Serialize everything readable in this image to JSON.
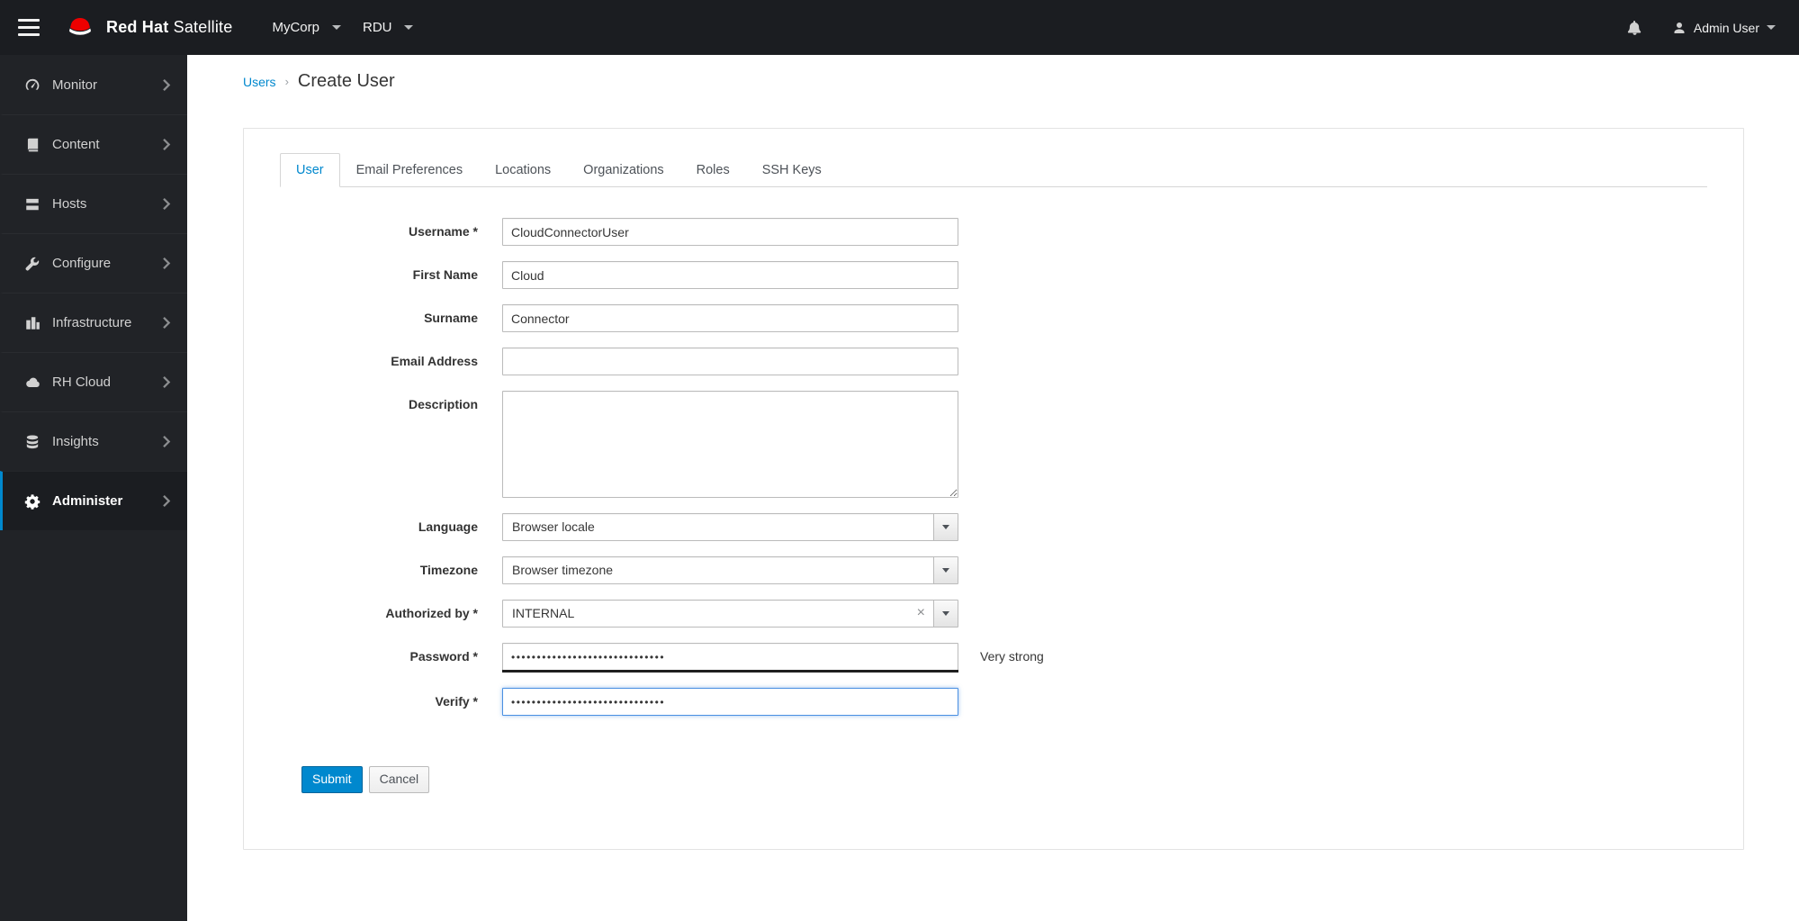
{
  "colors": {
    "accent_blue": "#0088ce",
    "brand_red": "#ee0000",
    "navbar_bg": "#1b1d21",
    "sidebar_bg": "#212327"
  },
  "navbar": {
    "brand_bold": "Red Hat",
    "brand_regular": "Satellite",
    "org_selector": "MyCorp",
    "location_selector": "RDU",
    "user_menu": "Admin User"
  },
  "sidebar": {
    "items": [
      {
        "label": "Monitor",
        "icon": "tachometer-icon"
      },
      {
        "label": "Content",
        "icon": "book-icon"
      },
      {
        "label": "Hosts",
        "icon": "server-icon"
      },
      {
        "label": "Configure",
        "icon": "wrench-icon"
      },
      {
        "label": "Infrastructure",
        "icon": "buildings-icon"
      },
      {
        "label": "RH Cloud",
        "icon": "cloud-icon"
      },
      {
        "label": "Insights",
        "icon": "database-icon"
      },
      {
        "label": "Administer",
        "icon": "gear-icon"
      }
    ]
  },
  "breadcrumb": {
    "parent": "Users",
    "separator": "›",
    "current": "Create User"
  },
  "tabs": [
    {
      "label": "User"
    },
    {
      "label": "Email Preferences"
    },
    {
      "label": "Locations"
    },
    {
      "label": "Organizations"
    },
    {
      "label": "Roles"
    },
    {
      "label": "SSH Keys"
    }
  ],
  "form": {
    "username": {
      "label": "Username *",
      "value": "CloudConnectorUser"
    },
    "first_name": {
      "label": "First Name",
      "value": "Cloud"
    },
    "surname": {
      "label": "Surname",
      "value": "Connector"
    },
    "email": {
      "label": "Email Address",
      "value": ""
    },
    "description": {
      "label": "Description",
      "value": ""
    },
    "language": {
      "label": "Language",
      "selected": "Browser locale"
    },
    "timezone": {
      "label": "Timezone",
      "selected": "Browser timezone"
    },
    "authorized_by": {
      "label": "Authorized by *",
      "selected": "INTERNAL",
      "clear_symbol": "×"
    },
    "password": {
      "label": "Password *",
      "masked_value": "••••••••••••••••••••••••••••••",
      "strength_text": "Very strong"
    },
    "verify": {
      "label": "Verify *",
      "masked_value": "••••••••••••••••••••••••••••••"
    }
  },
  "actions": {
    "submit": "Submit",
    "cancel": "Cancel"
  }
}
